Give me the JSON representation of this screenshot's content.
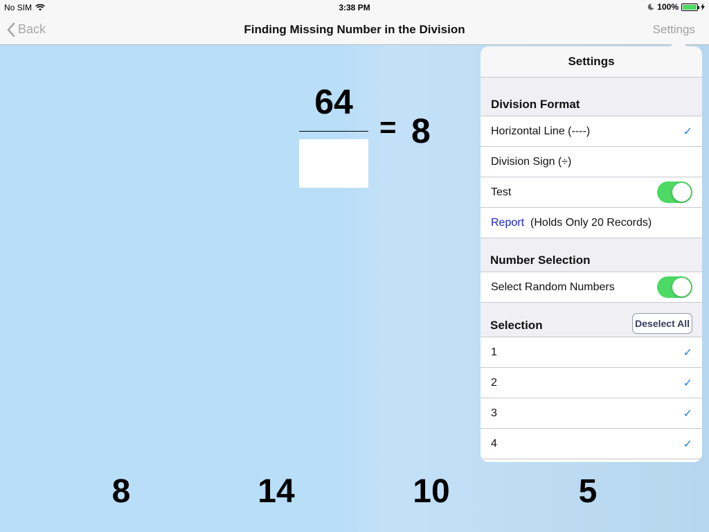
{
  "status_bar": {
    "carrier": "No SIM",
    "time": "3:38 PM",
    "battery": "100%"
  },
  "nav": {
    "back_label": "Back",
    "title": "Finding Missing Number in the Division",
    "settings_label": "Settings"
  },
  "problem": {
    "numerator": "64",
    "equals": "=",
    "result": "8"
  },
  "choices": [
    "8",
    "14",
    "10",
    "5"
  ],
  "settings": {
    "title": "Settings",
    "division_format": {
      "header": "Division Format",
      "horizontal_line": "Horizontal Line (----)",
      "division_sign": "Division Sign (÷)",
      "test": "Test",
      "test_on": true,
      "report_link": "Report",
      "report_note": "(Holds Only 20 Records)"
    },
    "number_selection": {
      "header": "Number Selection",
      "random_label": "Select Random Numbers",
      "random_on": true
    },
    "selection": {
      "header": "Selection",
      "deselect_label": "Deselect All",
      "items": [
        "1",
        "2",
        "3",
        "4"
      ]
    }
  },
  "colors": {
    "accent": "#1c7ef0",
    "toggle_on": "#4cd964",
    "link": "#1a23c7"
  }
}
